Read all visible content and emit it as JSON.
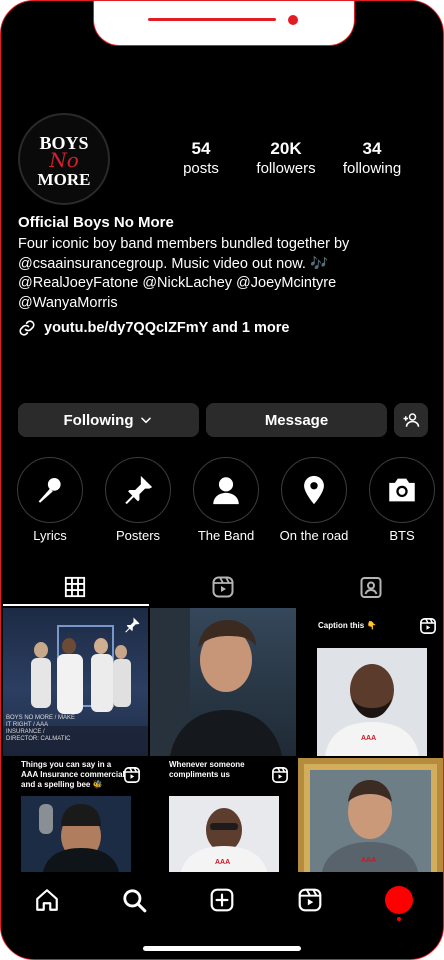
{
  "profile": {
    "name": "Official Boys No More",
    "bio_lines": [
      "Four iconic boy band members bundled together by",
      "@csaainsurancegroup. Music video out now. 🎶",
      "@RealJoeyFatone @NickLachey @JoeyMcintyre",
      "@WanyaMorris"
    ],
    "link_text": "youtu.be/dy7QQcIZFmY and 1 more",
    "avatar_logo": [
      "BOYS",
      "No",
      "MORE"
    ]
  },
  "stats": [
    {
      "value": "54",
      "label": "posts"
    },
    {
      "value": "20K",
      "label": "followers"
    },
    {
      "value": "34",
      "label": "following"
    }
  ],
  "buttons": {
    "following": "Following",
    "message": "Message"
  },
  "highlights": [
    {
      "label": "Lyrics",
      "icon": "microphone-icon"
    },
    {
      "label": "Posters",
      "icon": "pushpin-icon"
    },
    {
      "label": "The Band",
      "icon": "person-icon"
    },
    {
      "label": "On the road",
      "icon": "location-pin-icon"
    },
    {
      "label": "BTS",
      "icon": "camera-icon"
    }
  ],
  "tabs": [
    "grid-icon",
    "reels-icon",
    "tagged-icon"
  ],
  "grid": [
    {
      "caption": "",
      "overlay_text": "BOYS NO MORE / MAKE IT RIGHT / AAA INSURANCE / DIRECTOR: CALMATIC",
      "badge": "pin-icon"
    },
    {
      "caption": "",
      "badge": ""
    },
    {
      "caption": "Caption this 👇",
      "badge": "reels-icon"
    },
    {
      "caption": "Things you can say in a AAA Insurance commercial and a spelling bee 🐝",
      "badge": "reels-icon"
    },
    {
      "caption": "Whenever someone compliments us",
      "badge": "reels-icon"
    },
    {
      "caption": "",
      "badge": ""
    }
  ],
  "nav": [
    "home-icon",
    "search-icon",
    "create-icon",
    "reels-icon",
    "profile-icon"
  ],
  "colors": {
    "accent": "#e31b23",
    "background": "#000000",
    "button": "#2b2b2b"
  }
}
